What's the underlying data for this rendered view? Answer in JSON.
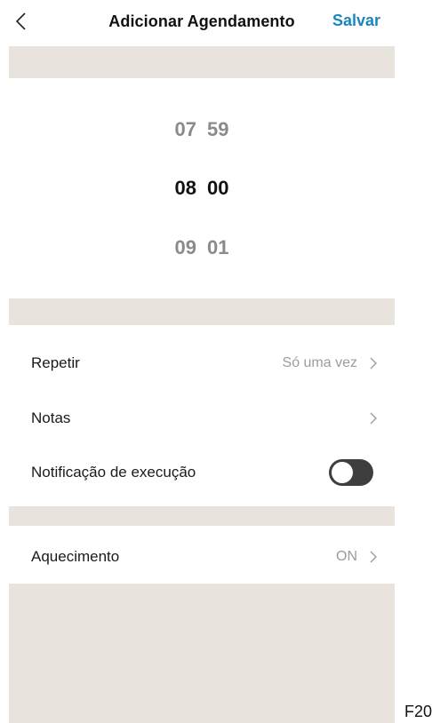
{
  "header": {
    "title": "Adicionar Agendamento",
    "save_label": "Salvar",
    "back_icon": "chevron-left-icon"
  },
  "time_picker": {
    "rows": [
      {
        "hour": "07",
        "minute": "59",
        "selected": false
      },
      {
        "hour": "08",
        "minute": "00",
        "selected": true
      },
      {
        "hour": "09",
        "minute": "01",
        "selected": false
      }
    ]
  },
  "settings": {
    "repeat": {
      "label": "Repetir",
      "value": "Só uma vez"
    },
    "notes": {
      "label": "Notas",
      "value": ""
    },
    "notification": {
      "label": "Notificação de execução",
      "enabled": false
    },
    "heating": {
      "label": "Aquecimento",
      "value": "ON"
    }
  },
  "corner_text": "F20",
  "colors": {
    "accent": "#1a86c0",
    "band": "#e8e4dd",
    "toggle_off": "#3e3e3e",
    "dim_text": "#8a8a8a"
  }
}
